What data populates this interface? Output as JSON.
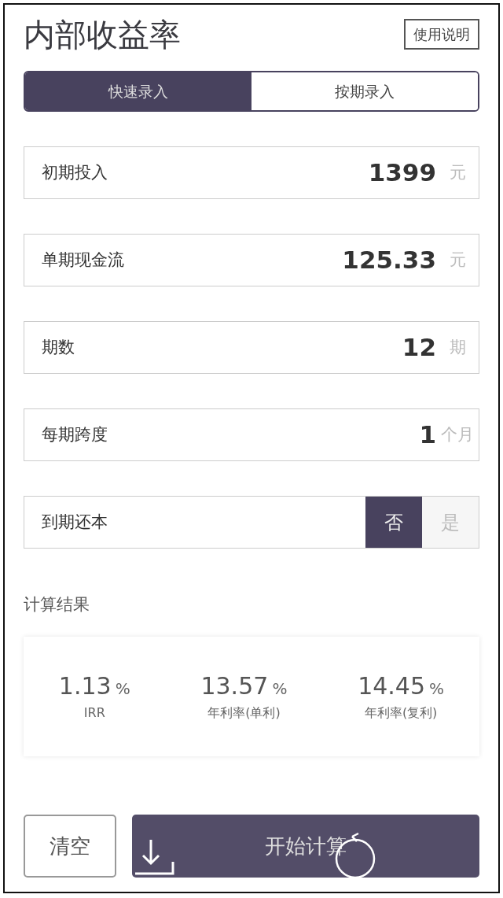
{
  "title": "内部收益率",
  "help_button": "使用说明",
  "tabs": [
    {
      "label": "快速录入",
      "selected": true
    },
    {
      "label": "按期录入",
      "selected": false
    }
  ],
  "fields": [
    {
      "kind": "input",
      "label": "初期投入",
      "value": "1399",
      "unit": "元"
    },
    {
      "kind": "input",
      "label": "单期现金流",
      "value": "125.33",
      "unit": "元"
    },
    {
      "kind": "input",
      "label": "期数",
      "value": "12",
      "unit": "期"
    },
    {
      "kind": "input",
      "label": "每期跨度",
      "value": "1",
      "unit": "个月"
    },
    {
      "kind": "toggle",
      "label": "到期还本",
      "options": [
        {
          "label": "否",
          "selected": true
        },
        {
          "label": "是",
          "selected": false
        }
      ]
    }
  ],
  "results_heading": "计算结果",
  "results": [
    {
      "value": "1.13",
      "unit": "%",
      "label": "IRR"
    },
    {
      "value": "13.57",
      "unit": "%",
      "label": "年利率(单利)"
    },
    {
      "value": "14.45",
      "unit": "%",
      "label": "年利率(复利)"
    }
  ],
  "clear_button": "清空",
  "calculate_button": "开始计算"
}
